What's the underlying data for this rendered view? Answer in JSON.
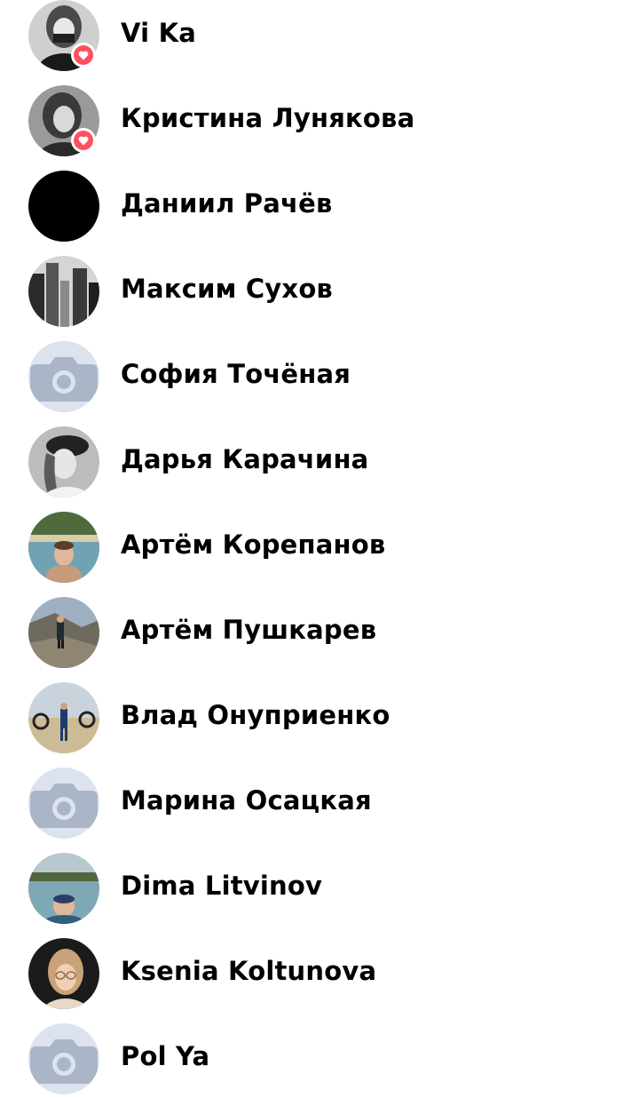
{
  "contacts": [
    {
      "name": "Vi Ka",
      "avatar": "photo-dark-portrait",
      "heart_badge": true
    },
    {
      "name": "Кристина Лунякова",
      "avatar": "photo-grayscale-portrait",
      "heart_badge": true
    },
    {
      "name": "Даниил Рачёв",
      "avatar": "photo-black",
      "heart_badge": false
    },
    {
      "name": "Максим Сухов",
      "avatar": "photo-city-buildings",
      "heart_badge": false
    },
    {
      "name": "София Точёная",
      "avatar": "camera-icon-placeholder",
      "heart_badge": false
    },
    {
      "name": "Дарья Карачина",
      "avatar": "photo-grayscale-portrait",
      "heart_badge": false
    },
    {
      "name": "Артём Корепанов",
      "avatar": "photo-sea-swimmer",
      "heart_badge": false
    },
    {
      "name": "Артём Пушкарев",
      "avatar": "photo-cliff-hiker",
      "heart_badge": false
    },
    {
      "name": "Влад Онуприенко",
      "avatar": "photo-beach-bikes",
      "heart_badge": false
    },
    {
      "name": "Марина Осацкая",
      "avatar": "camera-icon-placeholder",
      "heart_badge": false
    },
    {
      "name": "Dima Litvinov",
      "avatar": "photo-sea-swimmer",
      "heart_badge": false
    },
    {
      "name": "Ksenia Koltunova",
      "avatar": "photo-blonde-portrait",
      "heart_badge": false
    },
    {
      "name": "Pol Ya",
      "avatar": "camera-icon-placeholder",
      "heart_badge": false
    }
  ],
  "colors": {
    "placeholder_bg": "#dde3ee",
    "placeholder_icon": "#aab6c8",
    "heart_badge": "#ff4f5e",
    "text": "#000000"
  }
}
